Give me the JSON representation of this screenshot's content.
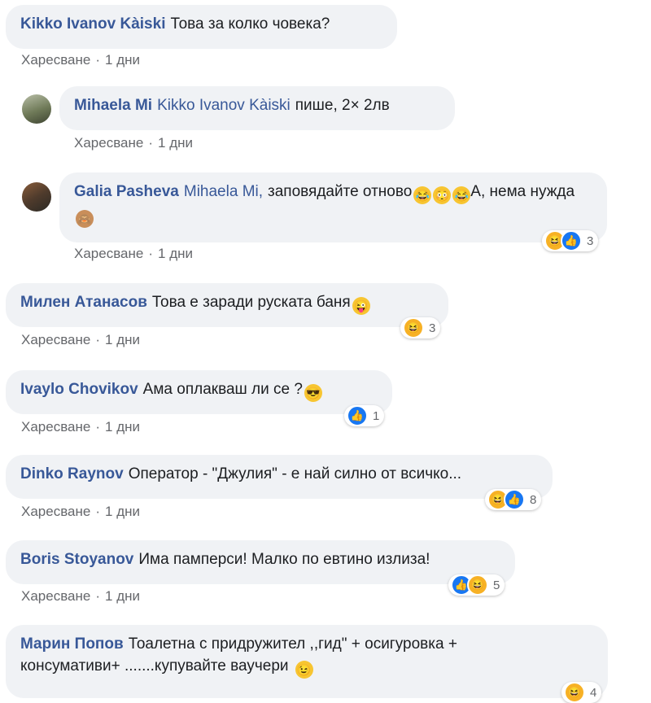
{
  "comments": [
    {
      "author": "Kikko Ivanov Kàiski",
      "mention": "",
      "text": "Това за колко човека?",
      "emoji": "",
      "like": "Харесване",
      "time": "1 дни",
      "reactions": "",
      "reaction_types": []
    },
    {
      "author": "Mihaela Mi",
      "mention": "Kikko Ivanov Kàiski",
      "text": "пише, 2× 2лв",
      "emoji": "",
      "like": "Харесване",
      "time": "1 дни",
      "reactions": "",
      "reaction_types": []
    },
    {
      "author": "Galia Pasheva",
      "mention": "Mihaela Mi,",
      "text": "заповядайте отново",
      "text2": "А, нема нужда",
      "emoji": "",
      "like": "Харесване",
      "time": "1 дни",
      "reactions": "3",
      "reaction_types": [
        "haha",
        "like"
      ]
    },
    {
      "author": "Милен Атанасов",
      "mention": "",
      "text": "Това е заради руската баня",
      "emoji": "",
      "like": "Харесване",
      "time": "1 дни",
      "reactions": "3",
      "reaction_types": [
        "haha"
      ]
    },
    {
      "author": "Ivaylo Chovikov",
      "mention": "",
      "text": "Ама оплакваш ли се ?",
      "emoji": "",
      "like": "Харесване",
      "time": "1 дни",
      "reactions": "1",
      "reaction_types": [
        "like"
      ]
    },
    {
      "author": "Dinko Raynov",
      "mention": "",
      "text": "Оператор - \"Джулия\" - е най силно от всичко...",
      "emoji": "",
      "like": "Харесване",
      "time": "1 дни",
      "reactions": "8",
      "reaction_types": [
        "haha",
        "like"
      ]
    },
    {
      "author": "Boris Stoyanov",
      "mention": "",
      "text": "Има памперси! Малко по евтино излиза!",
      "emoji": "",
      "like": "Харесване",
      "time": "1 дни",
      "reactions": "5",
      "reaction_types": [
        "like",
        "haha"
      ]
    },
    {
      "author": "Марин Попов",
      "mention": "",
      "text": "Тоалетна с придружител ,,гид\" + осигуровка +",
      "text2": "консумативи+ .......купувайте ваучери",
      "emoji": "",
      "like": "",
      "time": "",
      "reactions": "4",
      "reaction_types": [
        "haha"
      ]
    }
  ],
  "colors": {
    "author": "#385898",
    "bubble": "#f0f2f5",
    "meta": "#65676b",
    "like_reaction": "#1877f2",
    "haha_reaction": "#f7b125"
  }
}
